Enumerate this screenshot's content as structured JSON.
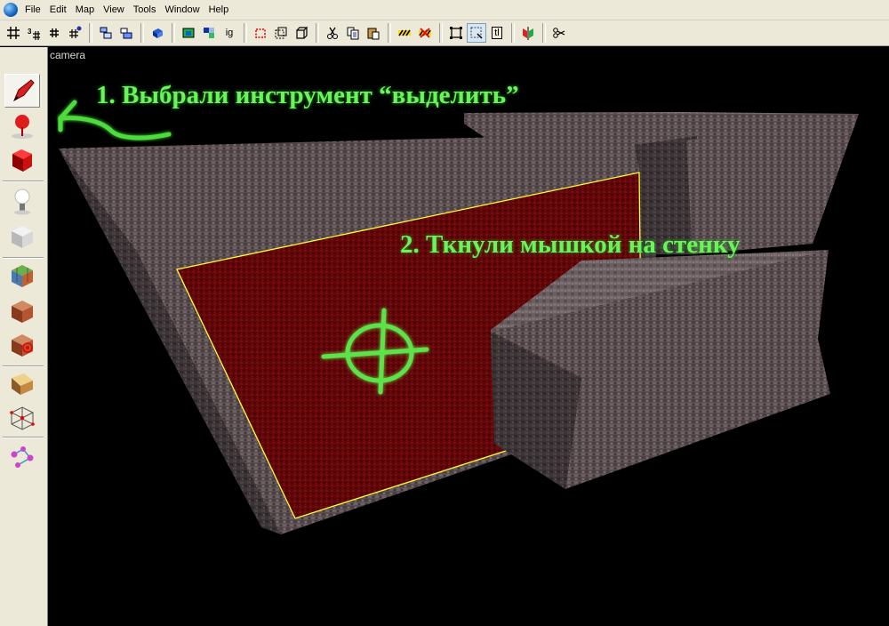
{
  "menubar": {
    "items": [
      "File",
      "Edit",
      "Map",
      "View",
      "Tools",
      "Window",
      "Help"
    ]
  },
  "toolbar": {
    "buttons": [
      "grid-icon",
      "grid-3d-icon",
      "grid-small-icon",
      "grid-snap-icon",
      "clone-icon",
      "clone-alt-icon",
      "brush-icon",
      "camera-view-icon",
      "render-icon",
      "ig-label",
      "select-box-icon",
      "select-group-icon",
      "cube-outline-icon",
      "cut-icon",
      "copy-icon",
      "paste-icon",
      "hazard-icon",
      "hazard-red-icon",
      "select-region-icon",
      "select-face-icon",
      "tl-label",
      "flip-icon",
      "scissors-clip-icon"
    ],
    "ig_label": "ig",
    "tl_label": "tl"
  },
  "left_tools": [
    "select-pen-icon",
    "entity-icon",
    "brush-red-icon",
    "light-icon",
    "cube-grey-icon",
    "texture-cube-icon",
    "brick-cube-icon",
    "target-cube-icon",
    "decal-icon",
    "wireframe-icon",
    "path-icon"
  ],
  "viewport": {
    "label": "camera",
    "annotation_1": "1. Выбрали инструмент “выделить”",
    "annotation_2": "2. Ткнули мышкой на стенку"
  },
  "colors": {
    "annotation": "#6cf25a",
    "selected_face": "#6b0a0c",
    "selection_outline": "#ffff33",
    "stone": "#5e5052"
  }
}
